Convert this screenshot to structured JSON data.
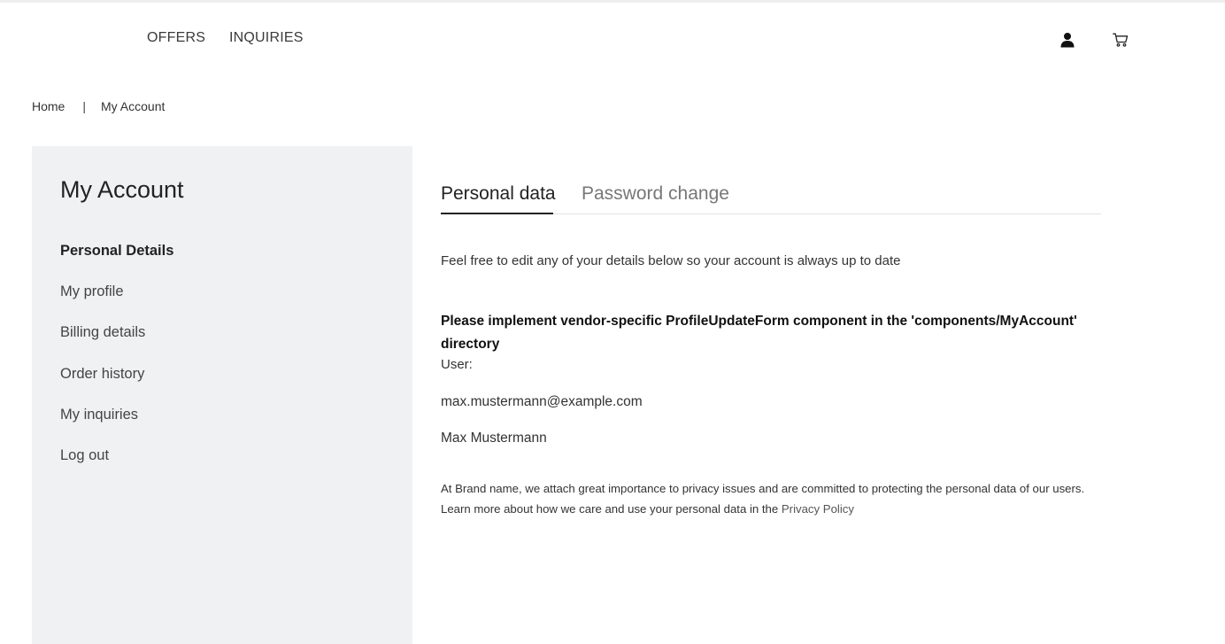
{
  "header": {
    "nav": [
      {
        "label": "OFFERS"
      },
      {
        "label": "INQUIRIES"
      }
    ],
    "icons": [
      "user-icon",
      "cart-icon"
    ]
  },
  "breadcrumb": {
    "home": "Home",
    "separator": "|",
    "current": "My Account"
  },
  "sidebar": {
    "title": "My Account",
    "items": [
      {
        "label": "Personal Details",
        "active": true
      },
      {
        "label": "My profile"
      },
      {
        "label": "Billing details"
      },
      {
        "label": "Order history"
      },
      {
        "label": "My inquiries"
      },
      {
        "label": "Log out"
      }
    ]
  },
  "tabs": [
    {
      "label": "Personal data",
      "active": true
    },
    {
      "label": "Password change"
    }
  ],
  "content": {
    "intro": "Feel free to edit any of your details below so your account is always up to date",
    "notice": "Please implement vendor-specific ProfileUpdateForm component in the 'components/MyAccount' directory",
    "user_label": "User:",
    "email": "max.mustermann@example.com",
    "name": "Max Mustermann",
    "privacy_text": "At Brand name, we attach great importance to privacy issues and are committed to protecting the personal data of our users. Learn more about how we care and use your personal data in the ",
    "privacy_link": "Privacy Policy"
  },
  "colors": {
    "sidebar_bg": "#f0f1f3",
    "tab_active": "#222222",
    "tab_inactive": "#777777"
  }
}
